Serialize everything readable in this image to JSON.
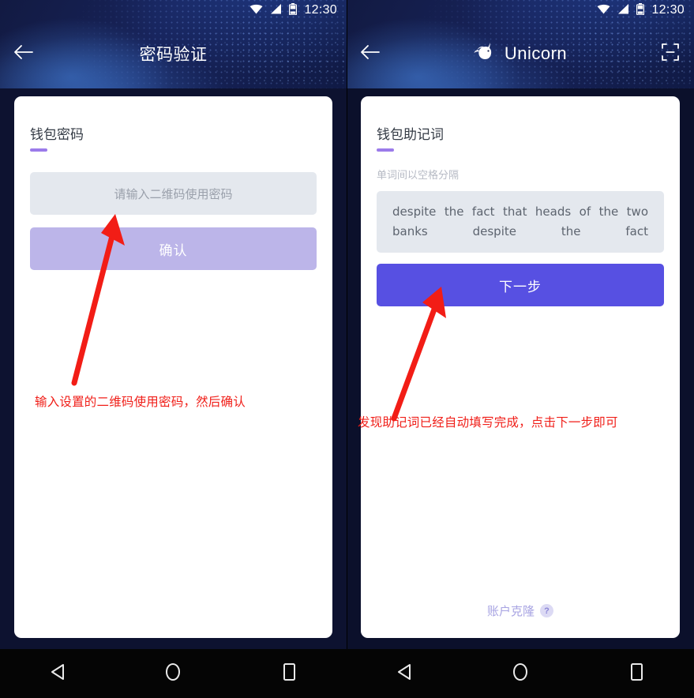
{
  "status_bar": {
    "time": "12:30",
    "icons": [
      "wifi-icon",
      "cellular-signal-icon",
      "battery-icon"
    ]
  },
  "left_screen": {
    "app_bar": {
      "back_icon": "back-arrow-icon",
      "title": "密码验证"
    },
    "card": {
      "title": "钱包密码",
      "password_input": {
        "placeholder": "请输入二维码使用密码",
        "value": ""
      },
      "confirm_button": "确认"
    },
    "annotation": "输入设置的二维码使用密码，然后确认"
  },
  "right_screen": {
    "app_bar": {
      "back_icon": "back-arrow-icon",
      "logo_icon": "unicorn-logo-icon",
      "title": "Unicorn",
      "scan_icon": "qr-scan-icon"
    },
    "card": {
      "title": "钱包助记词",
      "hint": "单词间以空格分隔",
      "mnemonic_value": "despite the fact that heads of the two banks despite the fact",
      "next_button": "下一步",
      "clone_link": "账户克隆",
      "clone_help_icon": "question-mark-icon"
    },
    "annotation": "发现助记词已经自动填写完成，点击下一步即可"
  },
  "nav_bar": {
    "back_icon": "nav-back-triangle-icon",
    "home_icon": "nav-home-circle-icon",
    "recents_icon": "nav-recents-square-icon"
  },
  "colors": {
    "accent_purple": "#9b7bea",
    "primary_button": "#5750e2",
    "disabled_button": "#bcb5e9",
    "annotation_red": "#f01e18",
    "field_bg": "#e4e8ee",
    "header_navy": "#17235a"
  }
}
